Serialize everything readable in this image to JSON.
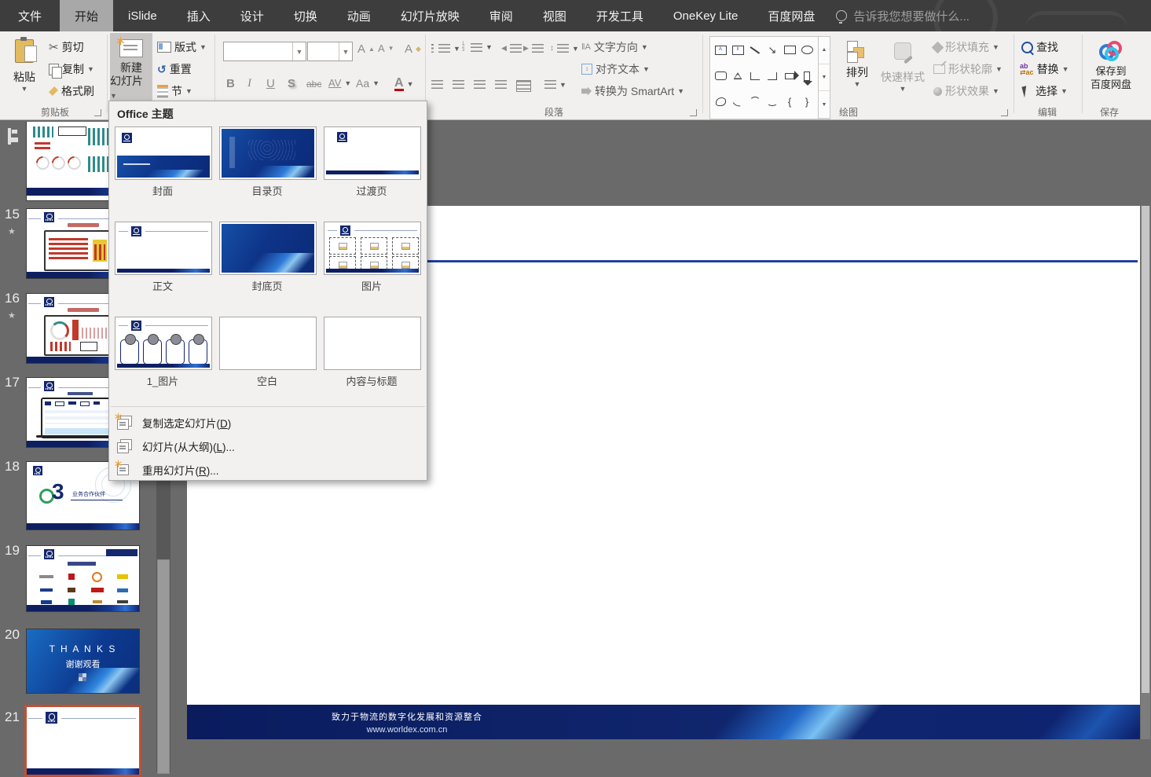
{
  "colors": {
    "brand_navy": "#14286E",
    "accent_blue": "#2F7BD8",
    "selection_orange": "#C05033",
    "titlebar_bg": "#3D3D3D",
    "ribbon_bg": "#F1F0EF",
    "workspace_bg": "#6A6A6A"
  },
  "titlebar": {
    "tabs": [
      {
        "label": "文件"
      },
      {
        "label": "开始",
        "active": true
      },
      {
        "label": "iSlide"
      },
      {
        "label": "插入"
      },
      {
        "label": "设计"
      },
      {
        "label": "切换"
      },
      {
        "label": "动画"
      },
      {
        "label": "幻灯片放映"
      },
      {
        "label": "审阅"
      },
      {
        "label": "视图"
      },
      {
        "label": "开发工具"
      },
      {
        "label": "OneKey Lite"
      },
      {
        "label": "百度网盘"
      }
    ],
    "tellme": "告诉我您想要做什么..."
  },
  "ribbon": {
    "clipboard": {
      "group_label": "剪贴板",
      "paste": "粘贴",
      "cut": "剪切",
      "copy": "复制",
      "format_painter": "格式刷"
    },
    "slides": {
      "new_slide_line1": "新建",
      "new_slide_line2": "幻灯片",
      "layout": "版式",
      "reset": "重置",
      "section": "节"
    },
    "font": {
      "bold": "B",
      "italic": "I",
      "underline": "U",
      "shadow": "S",
      "strikethrough": "abc",
      "char_spacing": "AV",
      "change_case": "Aa",
      "font_color": "A"
    },
    "paragraph": {
      "group_label": "段落",
      "text_direction": "文字方向",
      "align_text": "对齐文本",
      "smartart": "转换为 SmartArt"
    },
    "drawing": {
      "group_label": "绘图",
      "arrange": "排列",
      "quick_styles": "快速样式",
      "shape_fill": "形状填充",
      "shape_outline": "形状轮廓",
      "shape_effects": "形状效果"
    },
    "editing": {
      "group_label": "编辑",
      "find": "查找",
      "replace": "替换",
      "select": "选择"
    },
    "save": {
      "group_label": "保存",
      "button_line1": "保存到",
      "button_line2": "百度网盘"
    }
  },
  "new_slide_menu": {
    "header": "Office 主题",
    "layouts": [
      {
        "label": "封面"
      },
      {
        "label": "目录页"
      },
      {
        "label": "过渡页"
      },
      {
        "label": "正文"
      },
      {
        "label": "封底页"
      },
      {
        "label": "图片"
      },
      {
        "label": "1_图片"
      },
      {
        "label": "空白"
      },
      {
        "label": "内容与标题"
      }
    ],
    "items": [
      {
        "prefix": "复制选定幻灯片(",
        "key": "D",
        "suffix": ")"
      },
      {
        "prefix": "幻灯片(从大纲)(",
        "key": "L",
        "suffix": ")..."
      },
      {
        "prefix": "重用幻灯片(",
        "key": "R",
        "suffix": ")..."
      }
    ]
  },
  "slide_panel": {
    "slides": [
      {
        "number": "15",
        "animated": true
      },
      {
        "number": "16",
        "animated": true
      },
      {
        "number": "17",
        "animated": false
      },
      {
        "number": "18",
        "animated": false
      },
      {
        "number": "19",
        "animated": false
      },
      {
        "number": "20",
        "animated": false
      },
      {
        "number": "21",
        "animated": false,
        "selected": true
      }
    ],
    "thumb18": {
      "big_number": "3",
      "caption": "业务合作伙伴"
    },
    "thumb20": {
      "title": "T H A N K S",
      "subtitle": "谢谢观看"
    }
  },
  "slide": {
    "footer_line1": "致力于物流的数字化发展和资源整合",
    "footer_line2": "www.worldex.com.cn"
  }
}
